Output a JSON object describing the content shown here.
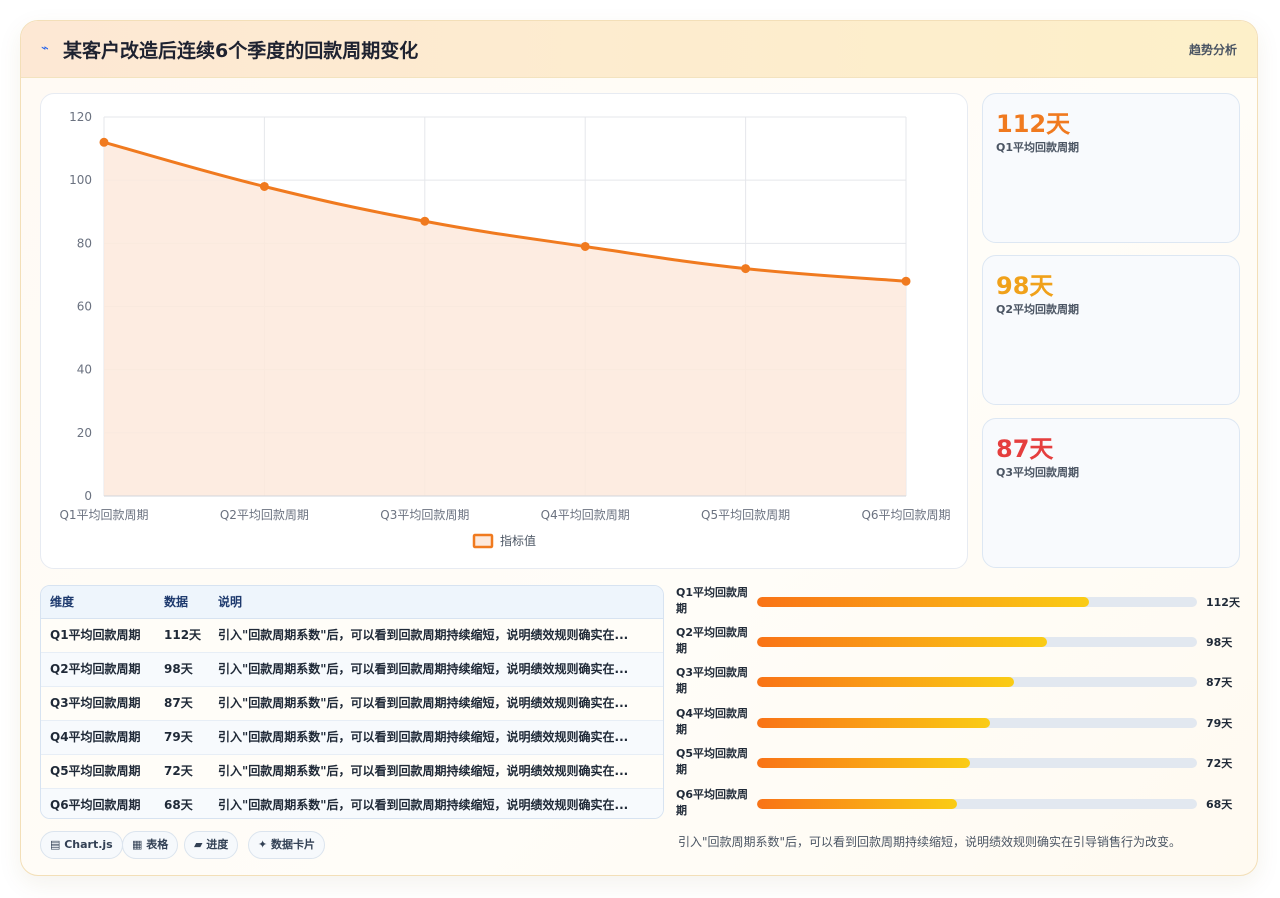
{
  "header": {
    "icon": "chart-icon",
    "title": "某客户改造后连续6个季度的回款周期变化",
    "tag": "趋势分析"
  },
  "chart_data": {
    "type": "line",
    "categories": [
      "Q1平均回款周期",
      "Q2平均回款周期",
      "Q3平均回款周期",
      "Q4平均回款周期",
      "Q5平均回款周期",
      "Q6平均回款周期"
    ],
    "series": [
      {
        "name": "指标值",
        "values": [
          112,
          98,
          87,
          79,
          72,
          68
        ]
      }
    ],
    "ylim": [
      0,
      120
    ],
    "yticks": [
      0,
      20,
      40,
      60,
      80,
      100,
      120
    ],
    "fill": true,
    "grid": true,
    "legend_position": "bottom",
    "line_color": "#f07a1f",
    "fill_color": "#fde9dc"
  },
  "stats": [
    {
      "value": "112天",
      "label": "Q1平均回款周期",
      "color": "#f07a1f"
    },
    {
      "value": "98天",
      "label": "Q2平均回款周期",
      "color": "#f0a11a"
    },
    {
      "value": "87天",
      "label": "Q3平均回款周期",
      "color": "#e53e3e"
    }
  ],
  "table": {
    "headers": [
      "维度",
      "数据",
      "说明"
    ],
    "rows": [
      {
        "dim": "Q1平均回款周期",
        "val": "112天",
        "desc": "引入\"回款周期系数\"后，可以看到回款周期持续缩短，说明绩效规则确实在..."
      },
      {
        "dim": "Q2平均回款周期",
        "val": "98天",
        "desc": "引入\"回款周期系数\"后，可以看到回款周期持续缩短，说明绩效规则确实在..."
      },
      {
        "dim": "Q3平均回款周期",
        "val": "87天",
        "desc": "引入\"回款周期系数\"后，可以看到回款周期持续缩短，说明绩效规则确实在..."
      },
      {
        "dim": "Q4平均回款周期",
        "val": "79天",
        "desc": "引入\"回款周期系数\"后，可以看到回款周期持续缩短，说明绩效规则确实在..."
      },
      {
        "dim": "Q5平均回款周期",
        "val": "72天",
        "desc": "引入\"回款周期系数\"后，可以看到回款周期持续缩短，说明绩效规则确实在..."
      },
      {
        "dim": "Q6平均回款周期",
        "val": "68天",
        "desc": "引入\"回款周期系数\"后，可以看到回款周期持续缩短，说明绩效规则确实在..."
      }
    ]
  },
  "progress": [
    {
      "label": "Q1平均回款周期",
      "value_text": "112天",
      "fraction": 0.755
    },
    {
      "label": "Q2平均回款周期",
      "value_text": "98天",
      "fraction": 0.66
    },
    {
      "label": "Q3平均回款周期",
      "value_text": "87天",
      "fraction": 0.585
    },
    {
      "label": "Q4平均回款周期",
      "value_text": "79天",
      "fraction": 0.53
    },
    {
      "label": "Q5平均回款周期",
      "value_text": "72天",
      "fraction": 0.485
    },
    {
      "label": "Q6平均回款周期",
      "value_text": "68天",
      "fraction": 0.455
    }
  ],
  "chips": [
    "▤ Chart.js",
    "▦ 表格",
    "▰ 进度",
    "✦ 数据卡片"
  ],
  "note": "引入\"回款周期系数\"后，可以看到回款周期持续缩短，说明绩效规则确实在引导销售行为改变。"
}
